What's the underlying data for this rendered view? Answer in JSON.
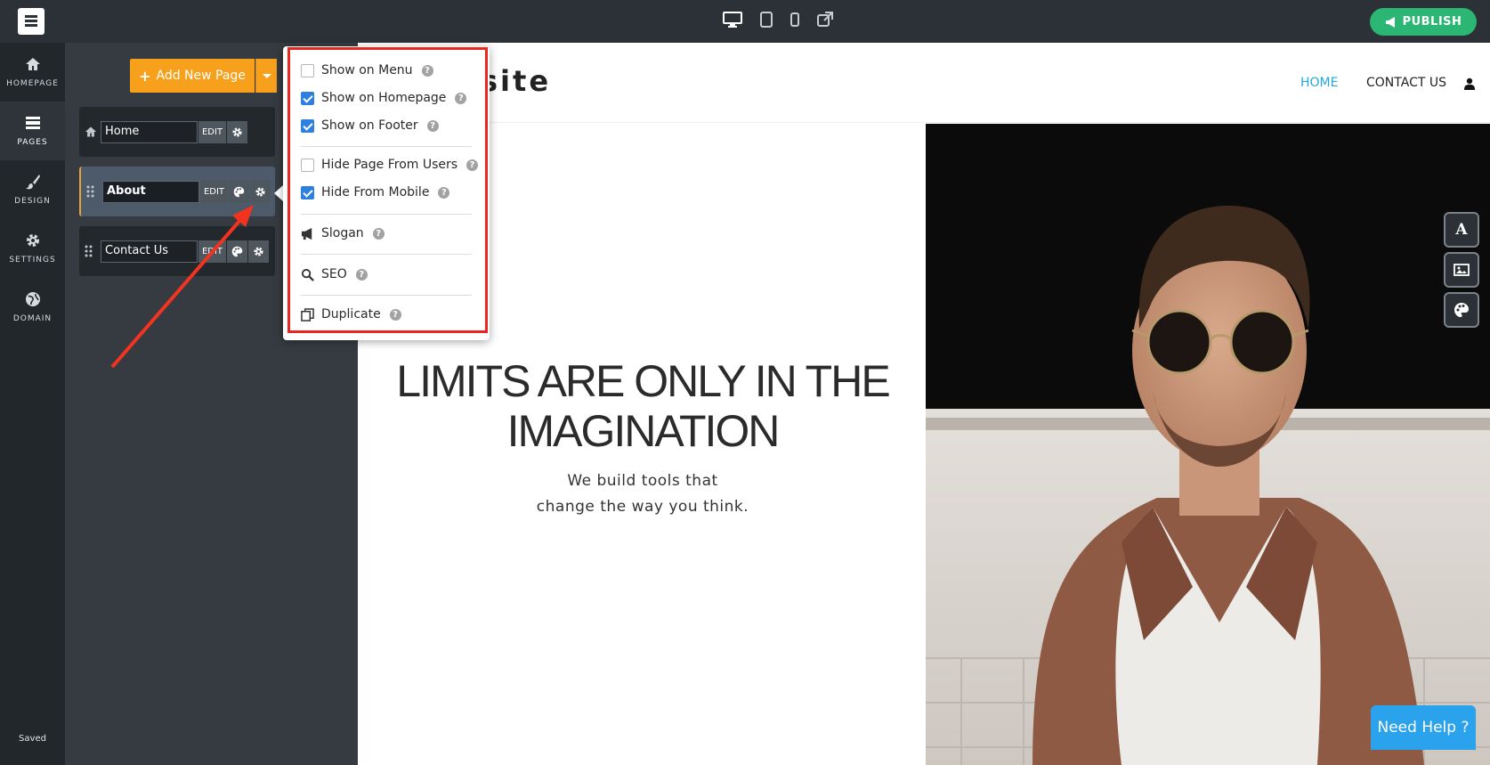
{
  "topbar": {
    "devices": [
      "desktop-icon",
      "tablet-icon",
      "mobile-icon",
      "external-link-icon"
    ],
    "publish_label": "PUBLISH"
  },
  "sidebar": {
    "items": [
      {
        "label": "HOMEPAGE",
        "icon": "home-icon"
      },
      {
        "label": "PAGES",
        "icon": "pages-icon"
      },
      {
        "label": "DESIGN",
        "icon": "brush-icon"
      },
      {
        "label": "SETTINGS",
        "icon": "gear-icon"
      },
      {
        "label": "DOMAIN",
        "icon": "globe-icon"
      }
    ],
    "status": "Saved"
  },
  "pages_panel": {
    "add_label": "Add New Page",
    "edit_label": "EDIT",
    "pages": [
      {
        "name": "Home"
      },
      {
        "name": "About"
      },
      {
        "name": "Contact Us"
      }
    ]
  },
  "popup": {
    "options": [
      {
        "label": "Show on Menu",
        "checked": false
      },
      {
        "label": "Show on Homepage",
        "checked": true
      },
      {
        "label": "Show on Footer",
        "checked": true
      },
      {
        "label": "Hide Page From Users",
        "checked": false
      },
      {
        "label": "Hide From Mobile",
        "checked": true
      }
    ],
    "actions": [
      {
        "label": "Slogan",
        "icon": "megaphone-icon"
      },
      {
        "label": "SEO",
        "icon": "search-icon"
      },
      {
        "label": "Duplicate",
        "icon": "copy-icon"
      }
    ],
    "help_mark": "?"
  },
  "site": {
    "brand": "site",
    "menu": [
      "HOME",
      "CONTACT US"
    ],
    "hero_title_line1": "LIMITS ARE ONLY IN THE",
    "hero_title_line2": "IMAGINATION",
    "hero_sub_line1": "We build tools that",
    "hero_sub_line2": "change the way you think.",
    "help_label": "Need Help ?"
  },
  "colors": {
    "accent_orange": "#f7a01c",
    "publish_green": "#2bb673",
    "highlight_red": "#e8271f",
    "menu_active": "#24a8d8",
    "help_blue": "#2aa2ec"
  }
}
